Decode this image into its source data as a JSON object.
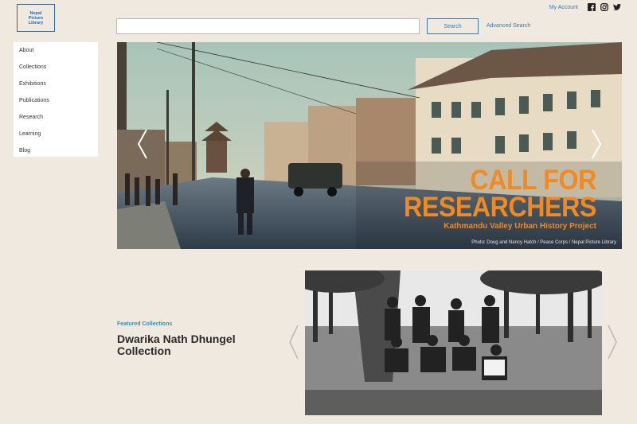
{
  "brand": {
    "logo_lines": [
      "Nepal",
      "Picture",
      "Library"
    ]
  },
  "header": {
    "account_label": "My Account",
    "social_icons": [
      "facebook-icon",
      "instagram-icon",
      "twitter-icon"
    ],
    "search": {
      "placeholder": "",
      "button_label": "Search"
    },
    "advanced_search_label": "Advanced Search"
  },
  "sidebar": {
    "items": [
      {
        "label": "About"
      },
      {
        "label": "Collections"
      },
      {
        "label": "Exhibitions"
      },
      {
        "label": "Publications"
      },
      {
        "label": "Research"
      },
      {
        "label": "Learning"
      },
      {
        "label": "Blog"
      }
    ]
  },
  "hero": {
    "title_line1": "CALL FOR",
    "title_line2": "RESEARCHERS",
    "subtitle": "Kathmandu Valley Urban History Project",
    "credit": "Photo: Doug and Nancy Hatch / Peace Corps / Nepal Picture Library"
  },
  "featured": {
    "label": "Featured Collections",
    "title": "Dwarika Nath Dhungel Collection"
  },
  "colors": {
    "background": "#efe9df",
    "accent_blue": "#3a79b5",
    "hero_orange": "#f08a24",
    "featured_label": "#3a8fb0"
  }
}
